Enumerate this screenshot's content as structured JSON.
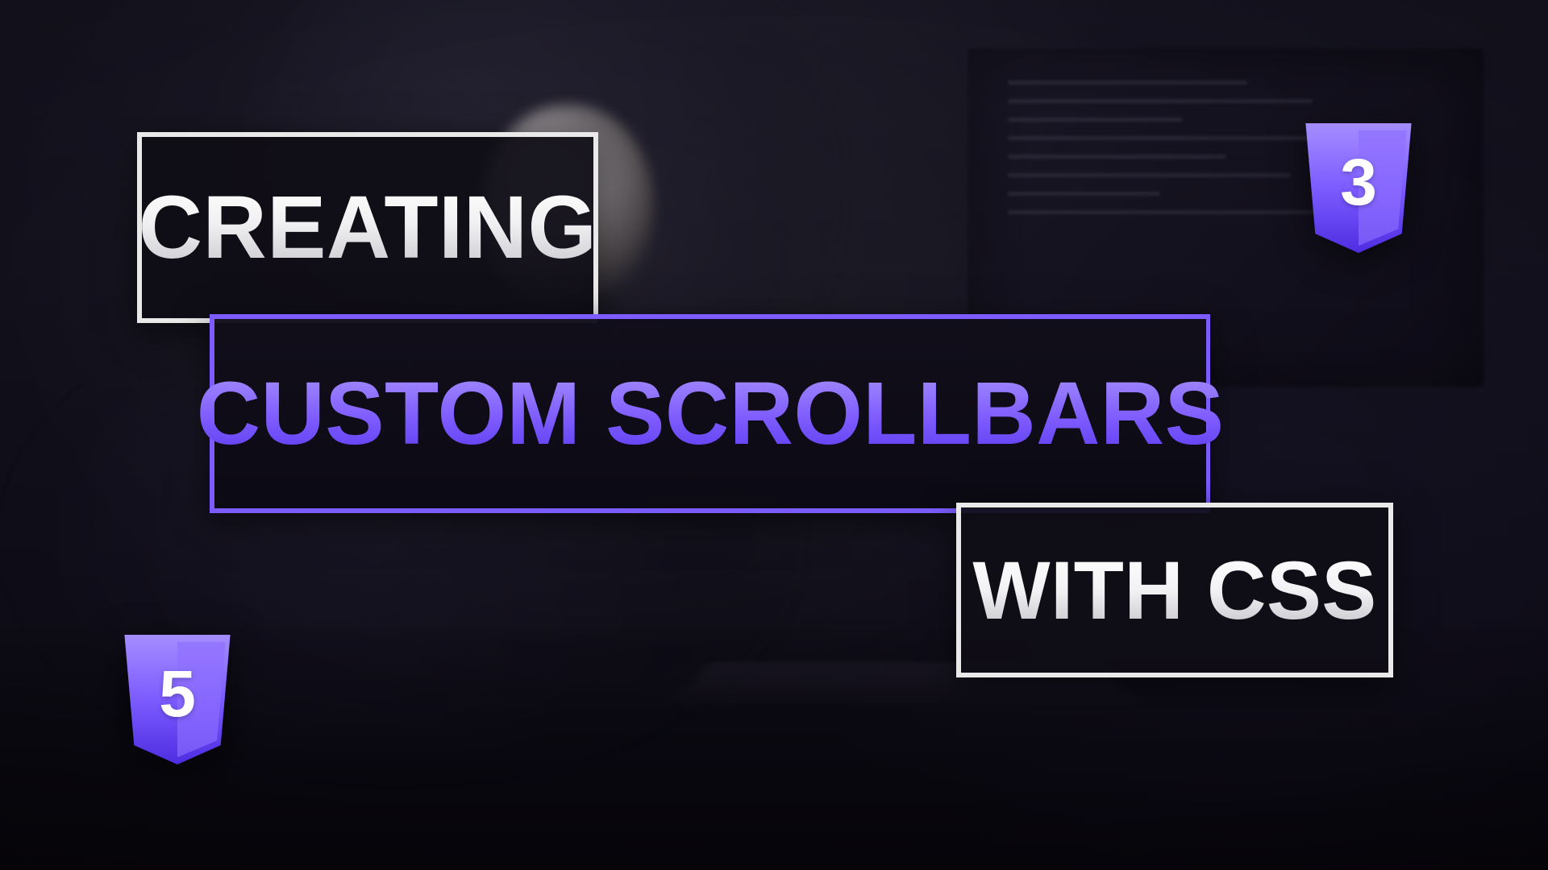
{
  "title": {
    "line1": "CREATING",
    "line2": "CUSTOM SCROLLBARS",
    "line3": "WITH CSS"
  },
  "icons": {
    "css3_badge_digit": "3",
    "html5_badge_digit": "5"
  },
  "colors": {
    "accent": "#7c5cff",
    "accent_light": "#a58dff",
    "white_border": "#e9e9ea",
    "panel_bg": "#0f0d16"
  }
}
